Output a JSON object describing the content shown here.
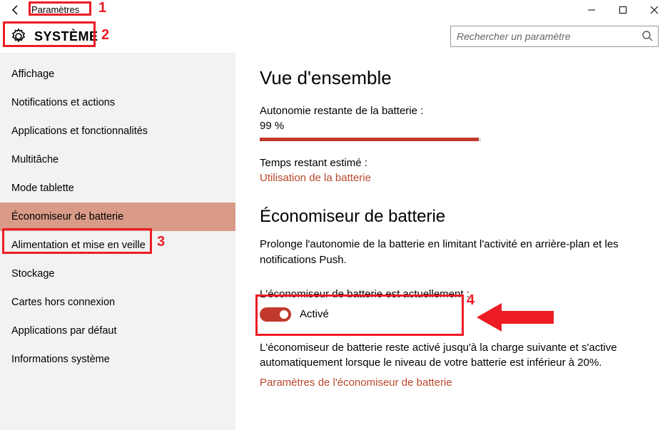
{
  "window": {
    "title": "Paramètres"
  },
  "header": {
    "section": "SYSTÈME",
    "search_placeholder": "Rechercher un paramètre"
  },
  "sidebar": {
    "items": [
      {
        "label": "Affichage"
      },
      {
        "label": "Notifications et actions"
      },
      {
        "label": "Applications et fonctionnalités"
      },
      {
        "label": "Multitâche"
      },
      {
        "label": "Mode tablette"
      },
      {
        "label": "Économiseur de batterie"
      },
      {
        "label": "Alimentation et mise en veille"
      },
      {
        "label": "Stockage"
      },
      {
        "label": "Cartes hors connexion"
      },
      {
        "label": "Applications par défaut"
      },
      {
        "label": "Informations système"
      }
    ],
    "selected_index": 5
  },
  "content": {
    "overview_heading": "Vue d'ensemble",
    "battery_remaining_label": "Autonomie restante de la batterie :",
    "battery_remaining_value": "99 %",
    "battery_percent": 99,
    "time_remaining_label": "Temps restant estimé :",
    "battery_usage_link": "Utilisation de la batterie",
    "saver_heading": "Économiseur de batterie",
    "saver_desc": "Prolonge l'autonomie de la batterie en limitant l'activité en arrière-plan et les notifications Push.",
    "toggle_label": "L'économiseur de batterie est actuellement :",
    "toggle_state": "Activé",
    "toggle_on": true,
    "saver_desc2": "L'économiseur de batterie reste activé jusqu'à la charge suivante et s'active automatiquement lorsque le niveau de votre batterie est inférieur à 20%.",
    "saver_settings_link": "Paramètres de l'économiseur de batterie"
  },
  "annotations": {
    "n1": "1",
    "n2": "2",
    "n3": "3",
    "n4": "4"
  }
}
